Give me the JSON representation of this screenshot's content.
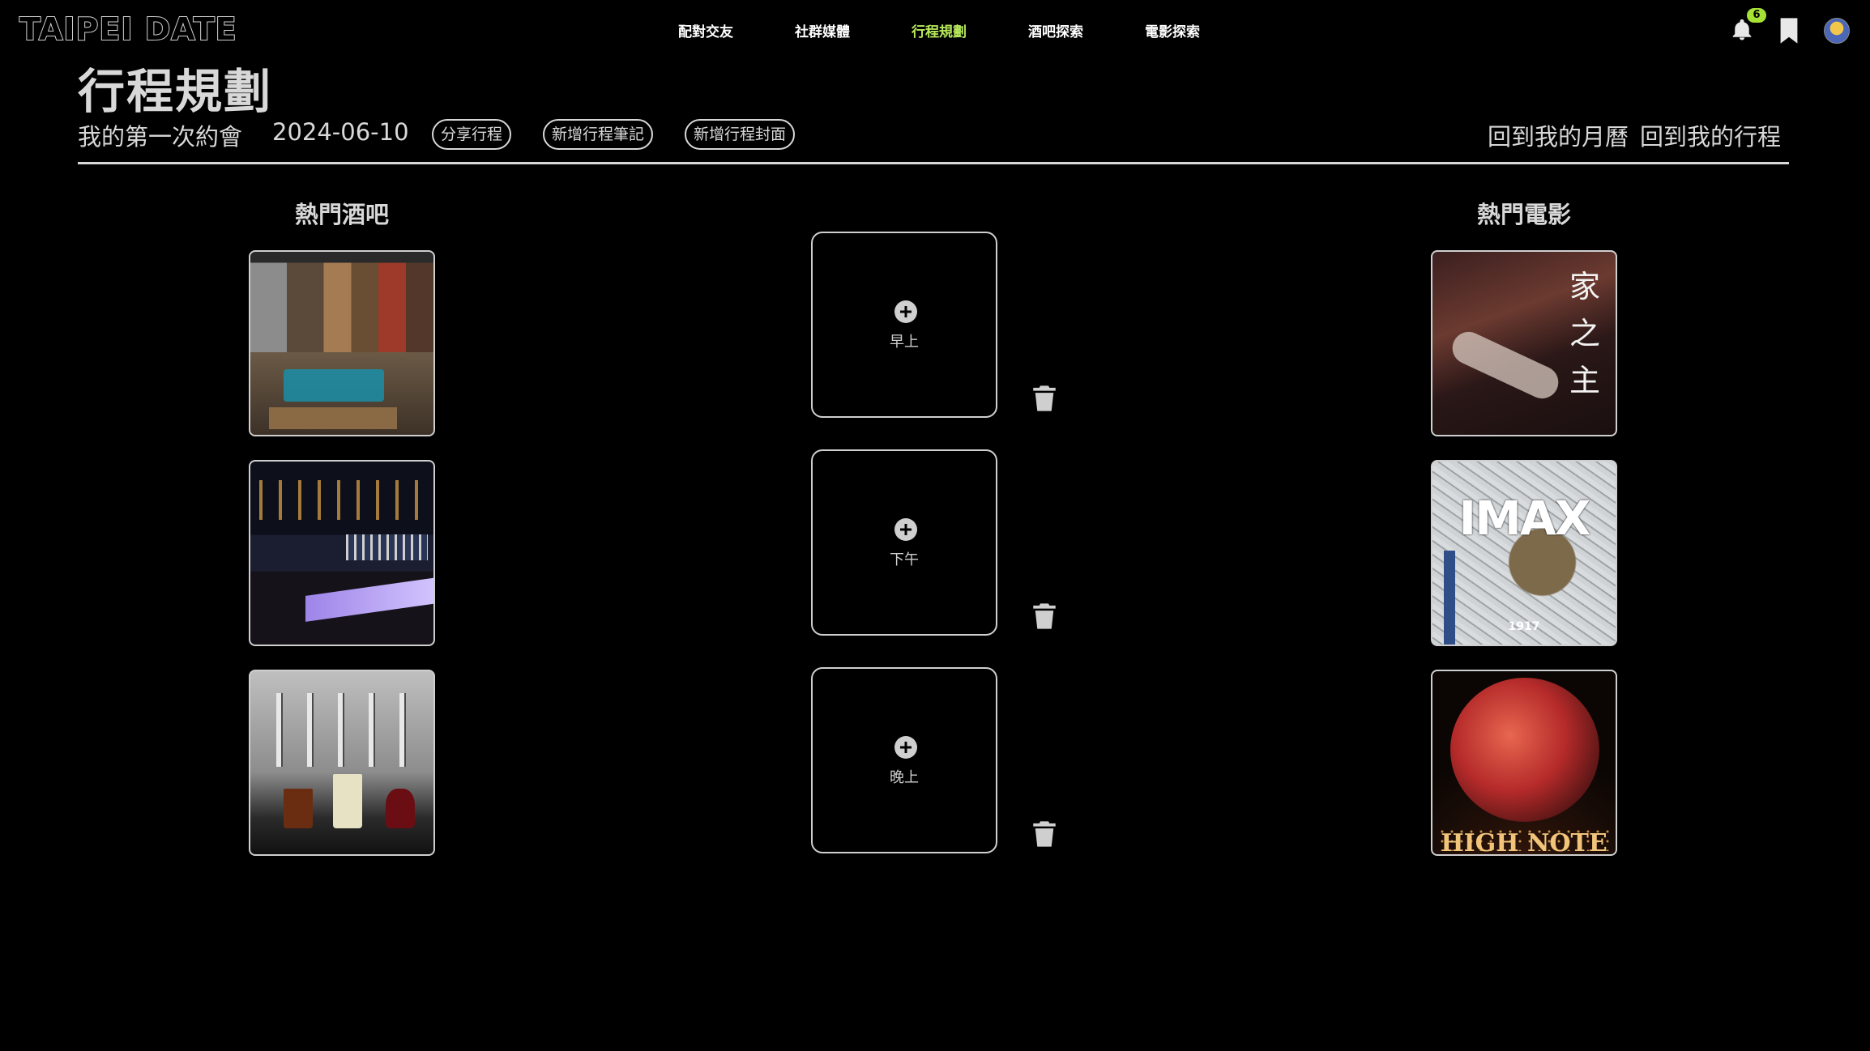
{
  "app": {
    "logo": "TAIPEI DATE"
  },
  "nav": {
    "items": [
      "配對交友",
      "社群媒體",
      "行程規劃",
      "酒吧探索",
      "電影探索"
    ],
    "active_index": 2,
    "active_color": "#b6e85a"
  },
  "header_icons": {
    "notifications_count": "6",
    "bell_icon": "bell-icon",
    "bookmark_icon": "bookmark-icon"
  },
  "page": {
    "title": "行程規劃",
    "trip_name": "我的第一次約會",
    "trip_date": "2024-06-10",
    "buttons": {
      "share": "分享行程",
      "add_note": "新增行程筆記",
      "add_cover": "新增行程封面"
    },
    "links": {
      "my_calendar": "回到我的月曆",
      "my_trips": "回到我的行程"
    }
  },
  "bars": {
    "title": "熱門酒吧",
    "items": [
      {
        "image": "bar-lounge-photo"
      },
      {
        "image": "bar-counter-photo"
      },
      {
        "image": "bar-taps-photo"
      }
    ]
  },
  "schedule": {
    "slots": [
      {
        "label": "早上"
      },
      {
        "label": "下午"
      },
      {
        "label": "晚上"
      }
    ],
    "add_icon": "plus-circle-icon",
    "delete_icon": "trash-icon"
  },
  "movies": {
    "title": "熱門電影",
    "items": [
      {
        "poster_text": "家之主"
      },
      {
        "poster_text": "IMAX",
        "year": "1917"
      },
      {
        "poster_text": "HIGH NOTE"
      }
    ]
  }
}
